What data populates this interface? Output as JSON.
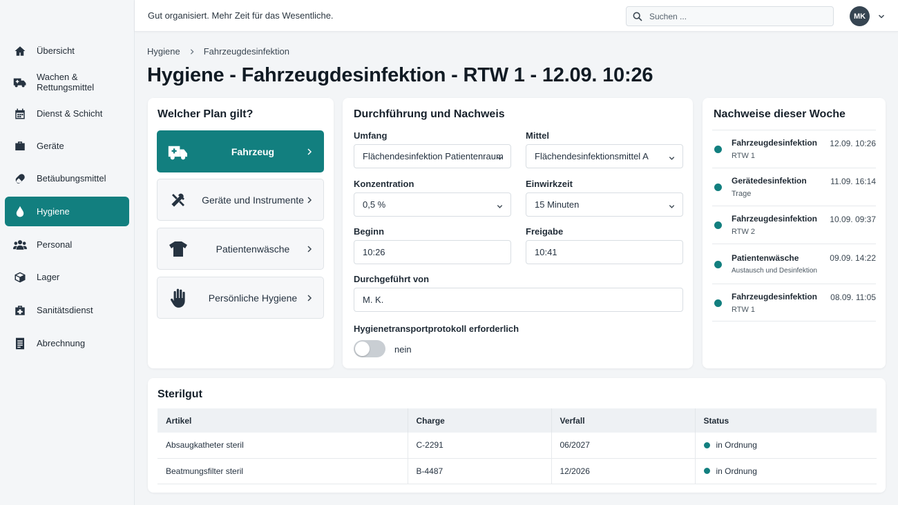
{
  "colors": {
    "accent": "#127f7f",
    "sidebar_bg": "#f4f6f8",
    "avatar_bg": "#364552"
  },
  "topbar": {
    "tagline": "Gut organisiert. Mehr Zeit für das Wesentliche.",
    "search_placeholder": "Suchen ...",
    "avatar_initials": "MK"
  },
  "sidebar": {
    "items": [
      {
        "label": "Übersicht",
        "icon": "home-icon"
      },
      {
        "label": "Wachen & Rettungsmittel",
        "icon": "ambulance-icon"
      },
      {
        "label": "Dienst & Schicht",
        "icon": "calendar-icon"
      },
      {
        "label": "Geräte",
        "icon": "briefcase-icon"
      },
      {
        "label": "Betäubungsmittel",
        "icon": "pill-icon"
      },
      {
        "label": "Hygiene",
        "icon": "drop-icon",
        "active": true
      },
      {
        "label": "Personal",
        "icon": "people-icon"
      },
      {
        "label": "Lager",
        "icon": "box-icon"
      },
      {
        "label": "Sanitätsdienst",
        "icon": "medical-cross-icon"
      },
      {
        "label": "Abrechnung",
        "icon": "document-icon"
      }
    ]
  },
  "breadcrumb": {
    "items": [
      "Hygiene",
      "Fahrzeugdesinfektion"
    ]
  },
  "page": {
    "title": "Hygiene - Fahrzeugdesinfektion - RTW 1 - 12.09. 10:26"
  },
  "plan": {
    "title": "Welcher Plan gilt?",
    "options": [
      {
        "label": "Fahrzeug",
        "icon": "ambulance-icon",
        "active": true
      },
      {
        "label": "Geräte und Instrumente",
        "icon": "tools-icon"
      },
      {
        "label": "Patientenwäsche",
        "icon": "shirt-icon"
      },
      {
        "label": "Persönliche Hygiene",
        "icon": "hand-icon"
      }
    ]
  },
  "form": {
    "title": "Durchführung und Nachweis",
    "umfang": {
      "label": "Umfang",
      "value": "Flächendesinfektion Patientenraum"
    },
    "mittel": {
      "label": "Mittel",
      "value": "Flächendesinfektionsmittel A"
    },
    "konzentration": {
      "label": "Konzentration",
      "value": "0,5 %"
    },
    "einwirkzeit": {
      "label": "Einwirkzeit",
      "value": "15 Minuten"
    },
    "beginn": {
      "label": "Beginn",
      "value": "10:26"
    },
    "freigabe": {
      "label": "Freigabe",
      "value": "10:41"
    },
    "durchgefuehrt": {
      "label": "Durchgeführt von",
      "value": "M. K."
    },
    "protokoll": {
      "label": "Hygienetransportprotokoll erforderlich",
      "state_text": "nein",
      "on": false
    }
  },
  "week": {
    "title": "Nachweise dieser Woche",
    "items": [
      {
        "title": "Fahrzeugdesinfektion",
        "sub": "RTW 1",
        "time": "12.09. 10:26"
      },
      {
        "title": "Gerätedesinfektion",
        "sub": "Trage",
        "time": "11.09. 16:14"
      },
      {
        "title": "Fahrzeugdesinfektion",
        "sub": "RTW 2",
        "time": "10.09. 09:37"
      },
      {
        "title": "Patientenwäsche",
        "sub": "Austausch und Desinfektion",
        "time": "09.09. 14:22"
      },
      {
        "title": "Fahrzeugdesinfektion",
        "sub": "RTW 1",
        "time": "08.09. 11:05"
      }
    ]
  },
  "steril": {
    "title": "Sterilgut",
    "columns": [
      "Artikel",
      "Charge",
      "Verfall",
      "Status"
    ],
    "rows": [
      {
        "artikel": "Absaugkatheter steril",
        "charge": "C-2291",
        "verfall": "06/2027",
        "status": "in Ordnung"
      },
      {
        "artikel": "Beatmungsfilter steril",
        "charge": "B-4487",
        "verfall": "12/2026",
        "status": "in Ordnung"
      }
    ]
  }
}
